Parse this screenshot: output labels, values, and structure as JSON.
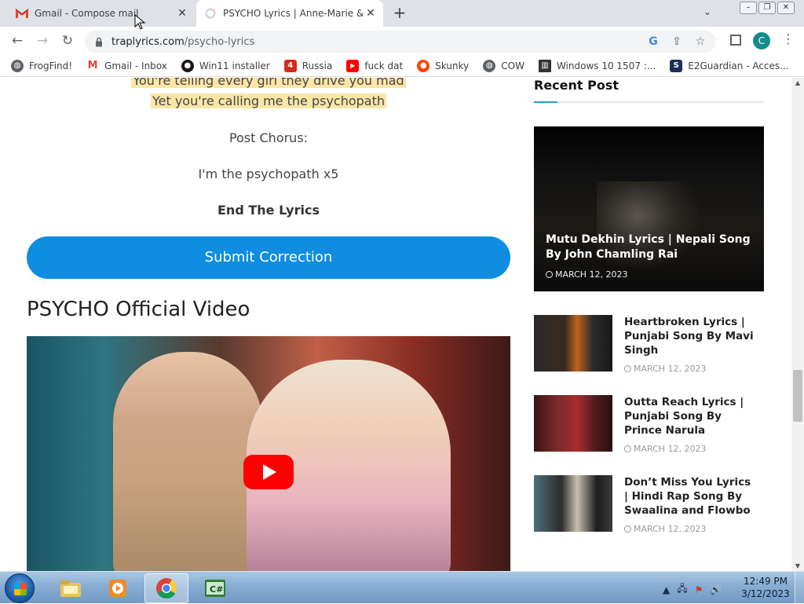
{
  "tabs": [
    {
      "title": "Gmail - Compose mail",
      "active": false,
      "icon": "gmail-icon"
    },
    {
      "title": "PSYCHO Lyrics | Anne-Marie & A",
      "active": true,
      "icon": "loading-icon"
    }
  ],
  "omnibox": {
    "url_host": "traplyrics.com",
    "url_path": "/psycho-lyrics"
  },
  "profile": {
    "initial": "C",
    "color": "#138d8a"
  },
  "bookmarks": [
    {
      "label": "FrogFind!",
      "icon": "globe-icon"
    },
    {
      "label": "Gmail - Inbox",
      "icon": "gmail-icon"
    },
    {
      "label": "Win11 installer",
      "icon": "github-icon"
    },
    {
      "label": "Russia",
      "icon": "flag-icon"
    },
    {
      "label": "fuck dat",
      "icon": "youtube-icon"
    },
    {
      "label": "Skunky",
      "icon": "reddit-icon"
    },
    {
      "label": "COW",
      "icon": "globe-icon"
    },
    {
      "label": "Windows 10 1507 :...",
      "icon": "archive-icon"
    },
    {
      "label": "E2Guardian - Acces...",
      "icon": "s-icon"
    }
  ],
  "lyrics": {
    "line1": "You're telling every girl they drive you mad",
    "line2": "Yet you're calling me the psychopath",
    "post_chorus_label": "Post Chorus:",
    "post_chorus_line": "I'm the psychopath x5",
    "end_label": "End The Lyrics"
  },
  "submit_button": "Submit Correction",
  "video_title": "PSYCHO Official Video",
  "sidebar": {
    "title": "Recent Post",
    "featured": {
      "title": "Mutu Dekhin Lyrics | Nepali Song By John Chamling Rai",
      "date": "MARCH 12, 2023"
    },
    "posts": [
      {
        "title": "Heartbroken Lyrics | Punjabi Song By Mavi Singh",
        "date": "MARCH 12, 2023"
      },
      {
        "title": "Outta Reach Lyrics | Punjabi Song By Prince Narula",
        "date": "MARCH 12, 2023"
      },
      {
        "title": "Don’t Miss You Lyrics | Hindi Rap Song By Swaalina and Flowbo",
        "date": "MARCH 12, 2023"
      }
    ]
  },
  "taskbar": {
    "apps": [
      "explorer-icon",
      "media-player-icon",
      "chrome-icon",
      "csharp-icon"
    ],
    "time": "12:49 PM",
    "date": "3/12/2023"
  },
  "colors": {
    "accent": "#0f8de0",
    "highlight": "#fbe6a6",
    "youtube_red": "#ff0000"
  }
}
